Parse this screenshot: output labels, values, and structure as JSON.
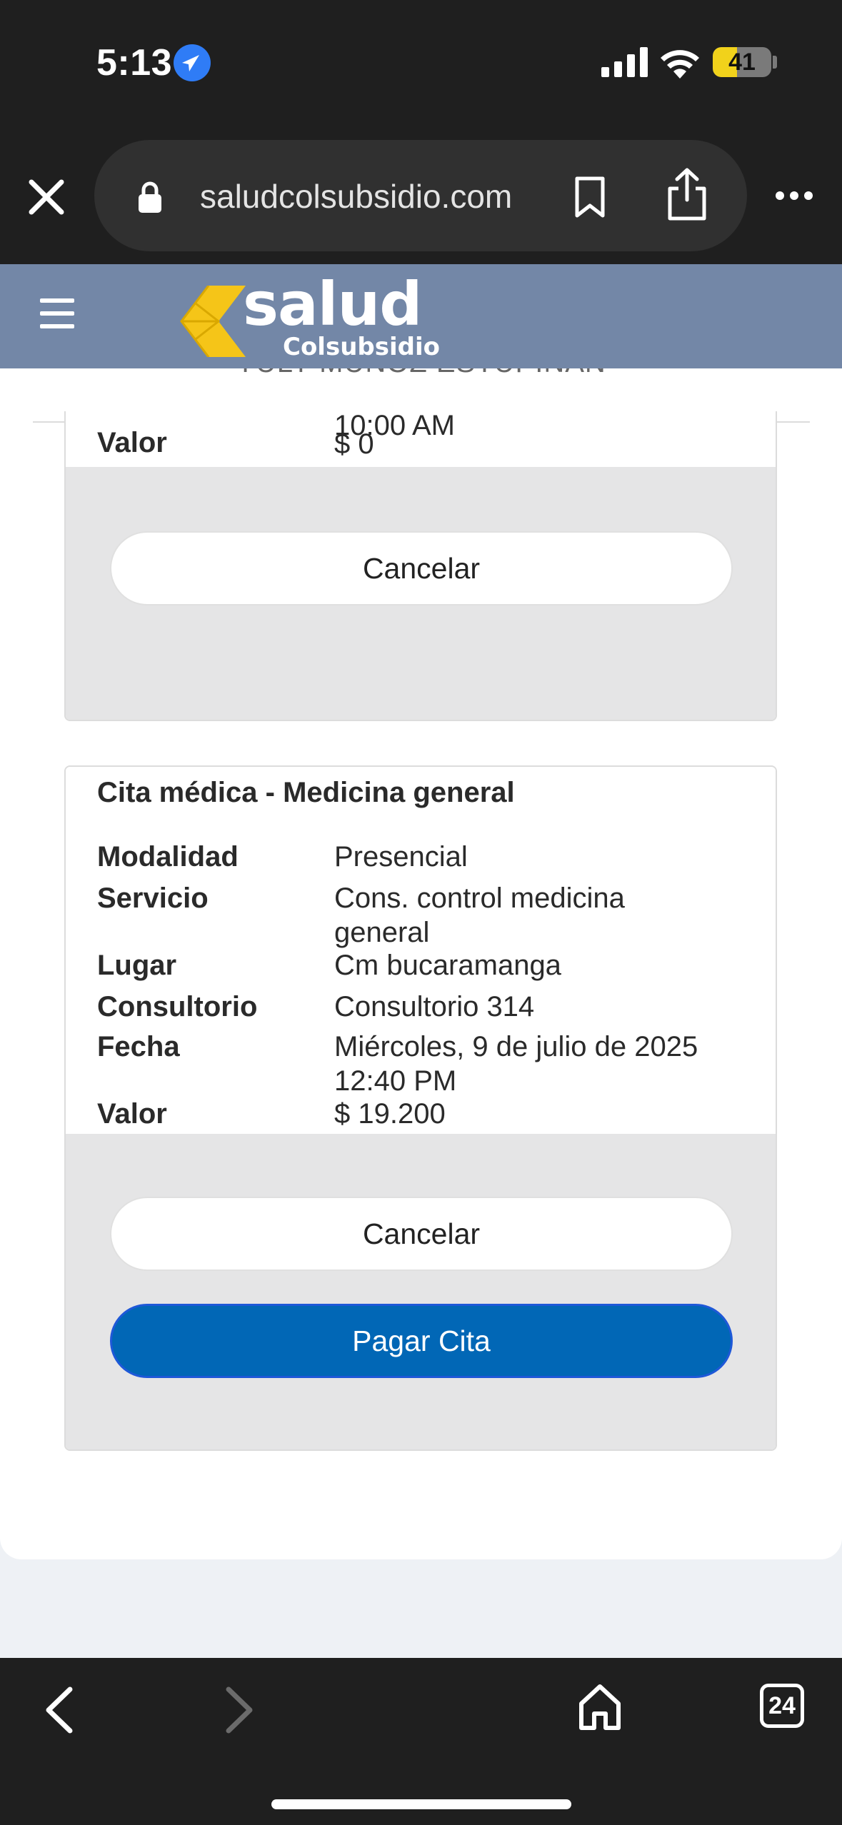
{
  "status_bar": {
    "time": "5:13",
    "battery": "41",
    "battery_level": 0.41
  },
  "browser": {
    "url": "saludcolsubsidio.com",
    "tab_count": "24"
  },
  "header": {
    "logo_text": "salud",
    "logo_subtext": "Colsubsidio"
  },
  "main": {
    "user_name": "YULY MUÑOZ ESTUPIÑAN",
    "appointments": [
      {
        "partial_time": "10:00 AM",
        "value_label": "Valor",
        "value": "$ 0",
        "cancel_label": "Cancelar"
      },
      {
        "title": "Cita médica - Medicina general",
        "modalidad_label": "Modalidad",
        "modalidad": "Presencial",
        "servicio_label": "Servicio",
        "servicio": "Cons. control medicina general",
        "lugar_label": "Lugar",
        "lugar": "Cm bucaramanga",
        "consultorio_label": "Consultorio",
        "consultorio": "Consultorio 314",
        "fecha_label": "Fecha",
        "fecha": "Miércoles, 9 de julio de 2025",
        "hora": "12:40 PM",
        "value_label": "Valor",
        "value": "$ 19.200",
        "cancel_label": "Cancelar",
        "pay_label": "Pagar Cita"
      }
    ]
  },
  "icons": {
    "close": "close-icon",
    "lock": "lock-icon",
    "bookmark": "bookmark-icon",
    "share": "share-icon",
    "more": "more-icon",
    "menu": "hamburger-menu-icon",
    "back": "back-arrow-icon",
    "forward": "forward-arrow-icon",
    "home": "home-icon"
  },
  "colors": {
    "header_bg": "#7387a7",
    "primary_button": "#0167b6",
    "tab_underline": "#1e6ab8",
    "logo_accent": "#f5c518"
  }
}
